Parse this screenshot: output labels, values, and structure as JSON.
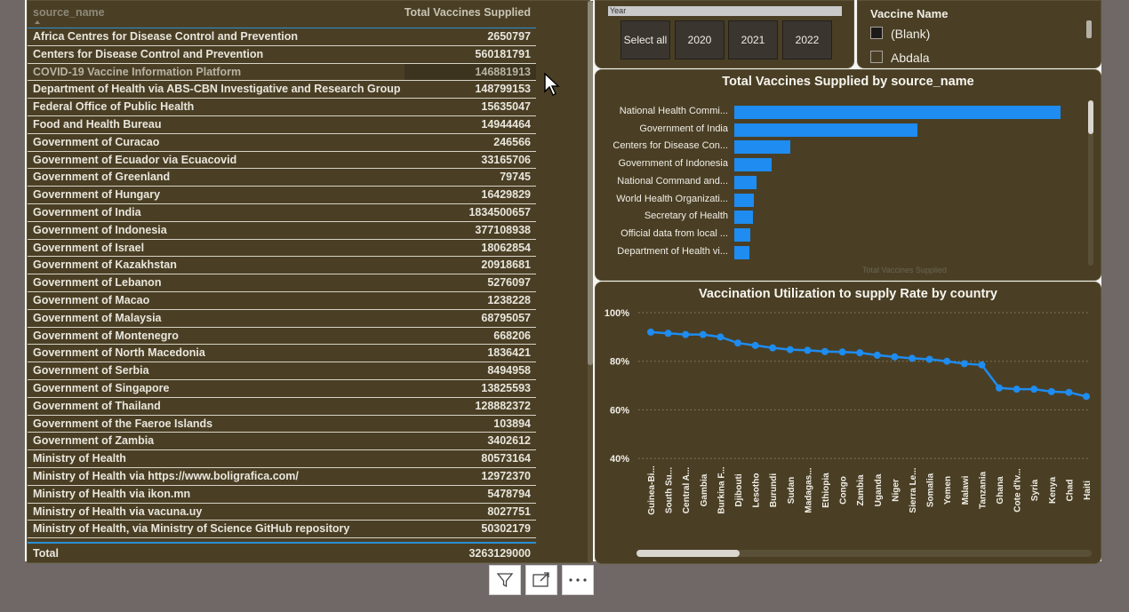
{
  "table": {
    "header": {
      "col1": "source_name",
      "col2": "Total Vaccines Supplied"
    },
    "rows": [
      {
        "name": "Africa Centres for Disease Control and Prevention",
        "value": "2650797"
      },
      {
        "name": "Centers for Disease Control and Prevention",
        "value": "560181791"
      },
      {
        "name": "COVID-19 Vaccine Information Platform",
        "value": "146881913"
      },
      {
        "name": "Department of Health via ABS-CBN Investigative and Research Group",
        "value": "148799153"
      },
      {
        "name": "Federal Office of Public Health",
        "value": "15635047"
      },
      {
        "name": "Food and Health Bureau",
        "value": "14944464"
      },
      {
        "name": "Government of Curacao",
        "value": "246566"
      },
      {
        "name": "Government of Ecuador via Ecuacovid",
        "value": "33165706"
      },
      {
        "name": "Government of Greenland",
        "value": "79745"
      },
      {
        "name": "Government of Hungary",
        "value": "16429829"
      },
      {
        "name": "Government of India",
        "value": "1834500657"
      },
      {
        "name": "Government of Indonesia",
        "value": "377108938"
      },
      {
        "name": "Government of Israel",
        "value": "18062854"
      },
      {
        "name": "Government of Kazakhstan",
        "value": "20918681"
      },
      {
        "name": "Government of Lebanon",
        "value": "5276097"
      },
      {
        "name": "Government of Macao",
        "value": "1238228"
      },
      {
        "name": "Government of Malaysia",
        "value": "68795057"
      },
      {
        "name": "Government of Montenegro",
        "value": "668206"
      },
      {
        "name": "Government of North Macedonia",
        "value": "1836421"
      },
      {
        "name": "Government of Serbia",
        "value": "8494958"
      },
      {
        "name": "Government of Singapore",
        "value": "13825593"
      },
      {
        "name": "Government of Thailand",
        "value": "128882372"
      },
      {
        "name": "Government of the Faeroe Islands",
        "value": "103894"
      },
      {
        "name": "Government of Zambia",
        "value": "3402612"
      },
      {
        "name": "Ministry of Health",
        "value": "80573164"
      },
      {
        "name": "Ministry of Health via https://www.boligrafica.com/",
        "value": "12972370"
      },
      {
        "name": "Ministry of Health via ikon.mn",
        "value": "5478794"
      },
      {
        "name": "Ministry of Health via vacuna.uy",
        "value": "8027751"
      },
      {
        "name": "Ministry of Health, via Ministry of Science GitHub repository",
        "value": "50302179"
      }
    ],
    "total_label": "Total",
    "total_value": "3263129000"
  },
  "year_slicer": {
    "title": "Year",
    "buttons": [
      "Select all",
      "2020",
      "2021",
      "2022"
    ]
  },
  "vaccine_slicer": {
    "title": "Vaccine Name",
    "items": [
      "(Blank)",
      "Abdala"
    ]
  },
  "toolbar": {
    "filter_icon": "filter-icon",
    "focus_icon": "focus-mode-icon",
    "more_icon": "more-options-icon"
  },
  "chart_data": [
    {
      "type": "bar",
      "title": "Total Vaccines Supplied by source_name",
      "xlabel": "Total Vaccines Supplied",
      "categories": [
        "National Health Commi...",
        "Government of India",
        "Centers for Disease Con...",
        "Government of Indonesia",
        "National Command and...",
        "World Health Organizati...",
        "Secretary of Health",
        "Official data from local ...",
        "Department of Health vi..."
      ],
      "values": [
        3270000000,
        1834500657,
        560181791,
        377108938,
        220000000,
        200000000,
        190000000,
        160000000,
        148799153
      ],
      "color": "#1e8cf0"
    },
    {
      "type": "line",
      "title": "Vaccination Utilization to supply Rate by country",
      "yticks": [
        "100%",
        "80%",
        "60%",
        "40%"
      ],
      "ylim": [
        0.4,
        1.0
      ],
      "categories": [
        "Guinea-Bi...",
        "South Su...",
        "Central A...",
        "Gambia",
        "Burkina F...",
        "Djibouti",
        "Lesotho",
        "Burundi",
        "Sudan",
        "Madagas...",
        "Ethiopia",
        "Congo",
        "Zambia",
        "Uganda",
        "Niger",
        "Sierra Le...",
        "Somalia",
        "Yemen",
        "Malawi",
        "Tanzania",
        "Ghana",
        "Cote d'Iv...",
        "Syria",
        "Kenya",
        "Chad",
        "Haiti"
      ],
      "values": [
        0.92,
        0.915,
        0.91,
        0.91,
        0.9,
        0.875,
        0.865,
        0.855,
        0.848,
        0.845,
        0.84,
        0.838,
        0.835,
        0.825,
        0.818,
        0.812,
        0.808,
        0.8,
        0.79,
        0.785,
        0.69,
        0.685,
        0.685,
        0.675,
        0.672,
        0.655
      ],
      "grid": true,
      "color": "#1e8cf0"
    }
  ]
}
